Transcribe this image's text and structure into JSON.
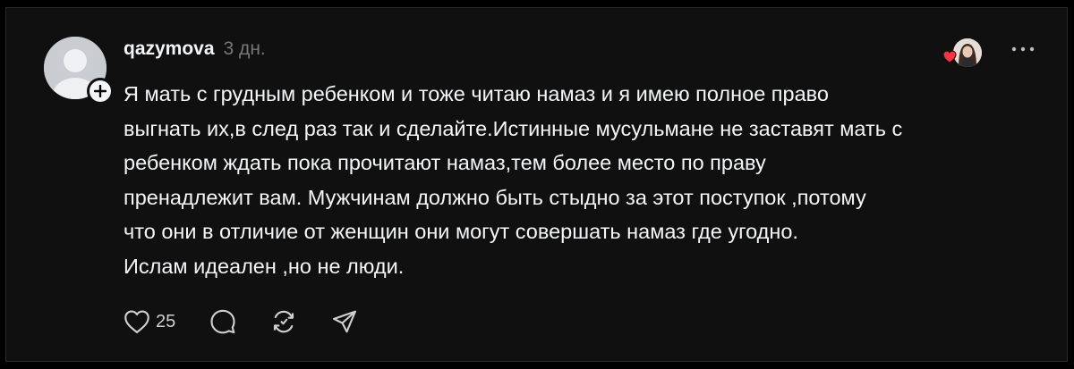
{
  "post": {
    "username": "qazymova",
    "timestamp": "3 дн.",
    "text": "Я мать с грудным ребенком и тоже читаю намаз и я имею полное право\nвыгнать их,в след раз так и сделайте.Истинные мусульмане не заставят мать с\nребенком ждать пока прочитают намаз,тем более место по праву\nпренадлежит вам. Мужчинам должно быть стыдно за этот поступок ,потому\nчто они в отличие от женщин они могут совершать намаз где угодно.\nИслам идеален ,но не люди.",
    "likes": "25"
  },
  "icons": {
    "avatar": "default-user-avatar",
    "follow": "plus-icon",
    "liked_heart": "heart-filled-icon",
    "liker_avatar": "user-photo-avatar",
    "more": "ellipsis-icon",
    "like": "heart-icon",
    "reply": "comment-bubble-icon",
    "repost": "repost-icon",
    "share": "send-icon"
  },
  "colors": {
    "background": "#000000",
    "card": "#101010",
    "text": "#f3f5f7",
    "secondary": "#777777",
    "heart": "#ff3040"
  }
}
